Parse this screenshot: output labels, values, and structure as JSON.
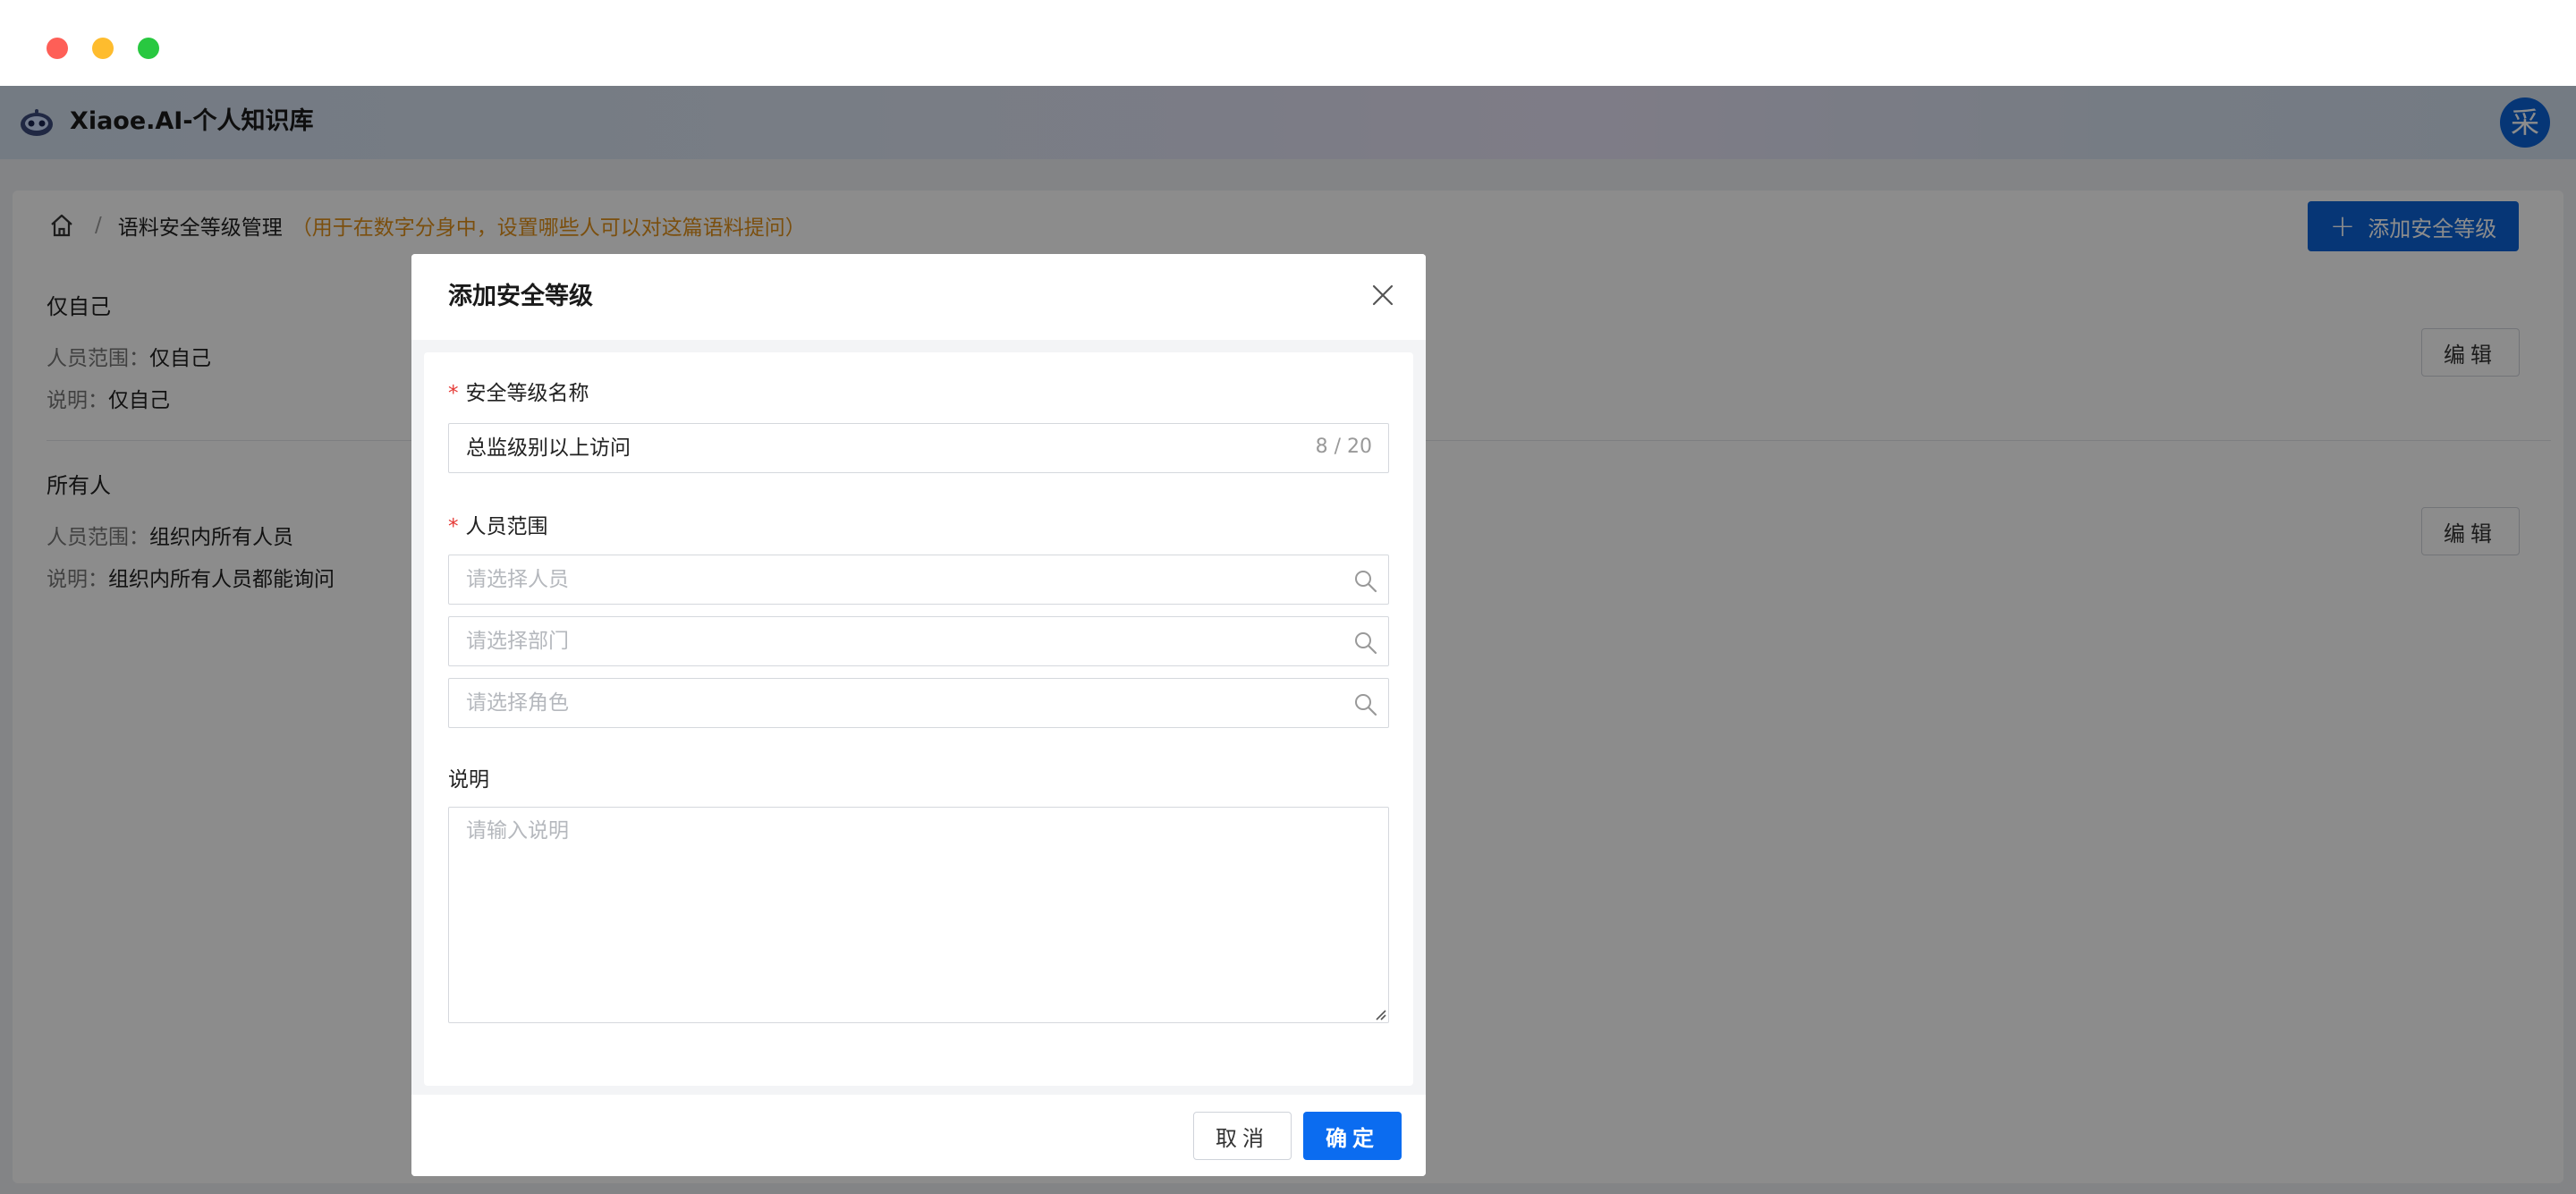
{
  "app": {
    "title": "Xiaoe.AI-个人知识库",
    "avatar_text": "采"
  },
  "breadcrumb": {
    "current": "语料安全等级管理",
    "note": "（用于在数字分身中，设置哪些人可以对这篇语料提问）"
  },
  "toolbar": {
    "add_label": "添加安全等级"
  },
  "levels": [
    {
      "title": "仅自己",
      "scope_label": "人员范围：",
      "scope_value": "仅自己",
      "desc_label": "说明：",
      "desc_value": "仅自己",
      "edit_label": "编辑"
    },
    {
      "title": "所有人",
      "scope_label": "人员范围：",
      "scope_value": "组织内所有人员",
      "desc_label": "说明：",
      "desc_value": "组织内所有人员都能询问",
      "edit_label": "编辑"
    }
  ],
  "modal": {
    "title": "添加安全等级",
    "name_label": "安全等级名称",
    "name_value": "总监级别以上访问",
    "name_counter": "8 / 20",
    "scope_label": "人员范围",
    "person_placeholder": "请选择人员",
    "dept_placeholder": "请选择部门",
    "role_placeholder": "请选择角色",
    "desc_label": "说明",
    "desc_placeholder": "请输入说明",
    "cancel_label": "取消",
    "ok_label": "确定",
    "required_mark": "*"
  },
  "colors": {
    "primary": "#0b63d8",
    "note": "#e0901a",
    "required": "#e53935"
  }
}
